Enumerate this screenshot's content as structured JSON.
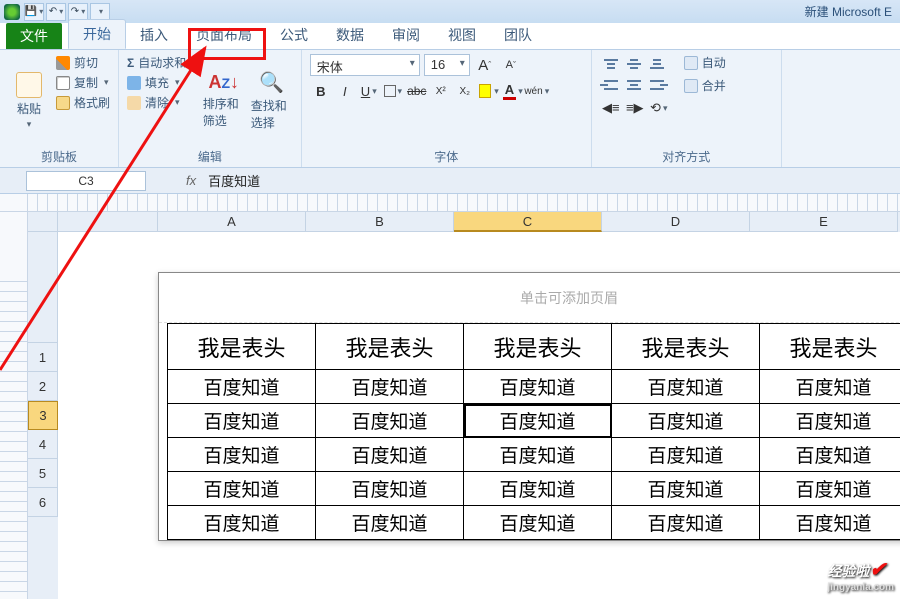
{
  "title": "新建 Microsoft E",
  "tabs": {
    "file": "文件",
    "home": "开始",
    "insert": "插入",
    "layout": "页面布局",
    "formula": "公式",
    "data": "数据",
    "review": "审阅",
    "view": "视图",
    "team": "团队"
  },
  "ribbon": {
    "clipboard": {
      "paste": "粘贴",
      "cut": "剪切",
      "copy": "复制",
      "brush": "格式刷",
      "label": "剪贴板"
    },
    "edit": {
      "sum": "自动求和",
      "fill": "填充",
      "clear": "清除",
      "sort": "排序和筛选",
      "find": "查找和选择",
      "label": "编辑"
    },
    "font": {
      "name": "宋体",
      "size": "16",
      "grow": "A",
      "shrink": "A",
      "bold": "B",
      "italic": "I",
      "underline": "U",
      "strike": "abc",
      "color": "A",
      "pinyin": "wén",
      "label": "字体"
    },
    "align": {
      "wrap": "自动",
      "merge": "合并",
      "label": "对齐方式"
    }
  },
  "namebox": "C3",
  "fx_label": "fx",
  "fx_value": "百度知道",
  "columns": [
    "A",
    "B",
    "C",
    "D",
    "E"
  ],
  "rows": [
    "1",
    "2",
    "3",
    "4",
    "5",
    "6"
  ],
  "sel_col_index": 2,
  "sel_row_index": 2,
  "page_header_hint": "单击可添加页眉",
  "table": {
    "headers": [
      "我是表头",
      "我是表头",
      "我是表头",
      "我是表头",
      "我是表头"
    ],
    "rows": [
      [
        "百度知道",
        "百度知道",
        "百度知道",
        "百度知道",
        "百度知道"
      ],
      [
        "百度知道",
        "百度知道",
        "百度知道",
        "百度知道",
        "百度知道"
      ],
      [
        "百度知道",
        "百度知道",
        "百度知道",
        "百度知道",
        "百度知道"
      ],
      [
        "百度知道",
        "百度知道",
        "百度知道",
        "百度知道",
        "百度知道"
      ],
      [
        "百度知道",
        "百度知道",
        "百度知道",
        "百度知道",
        "百度知道"
      ]
    ]
  },
  "watermark": {
    "text": "经验啦",
    "sub": "jingyanla.com"
  }
}
